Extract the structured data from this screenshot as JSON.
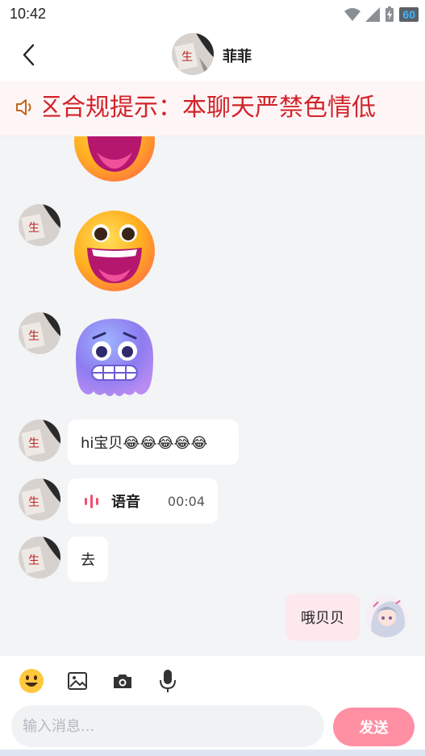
{
  "status_bar": {
    "time": "10:42",
    "battery": "60",
    "icons": [
      "wifi-icon",
      "signal-icon",
      "battery-charging-icon"
    ]
  },
  "header": {
    "back_icon": "chevron-left-icon",
    "contact_name": "菲菲"
  },
  "notice": {
    "icon": "speaker-icon",
    "text": "区合规提示：本聊天严禁色情低"
  },
  "messages": [
    {
      "from": "other",
      "type": "emoji",
      "emoji": "grinning-face-partial"
    },
    {
      "from": "other",
      "type": "emoji",
      "emoji": "grinning-face"
    },
    {
      "from": "other",
      "type": "emoji",
      "emoji": "cold-face"
    },
    {
      "from": "other",
      "type": "text",
      "text": "hi宝贝😂😂😂😂😂"
    },
    {
      "from": "other",
      "type": "voice",
      "label": "语音",
      "duration": "00:04"
    },
    {
      "from": "other",
      "type": "text",
      "text": "去"
    },
    {
      "from": "self",
      "type": "text",
      "text": "哦贝贝"
    }
  ],
  "toolbar": {
    "tools": [
      "emoji-icon",
      "image-icon",
      "camera-icon",
      "microphone-icon"
    ]
  },
  "composer": {
    "placeholder": "输入消息...",
    "value": "",
    "send_label": "发送"
  },
  "colors": {
    "accent": "#ff8fa3",
    "notice_text": "#d2232a",
    "self_bubble": "#fde8ed"
  }
}
